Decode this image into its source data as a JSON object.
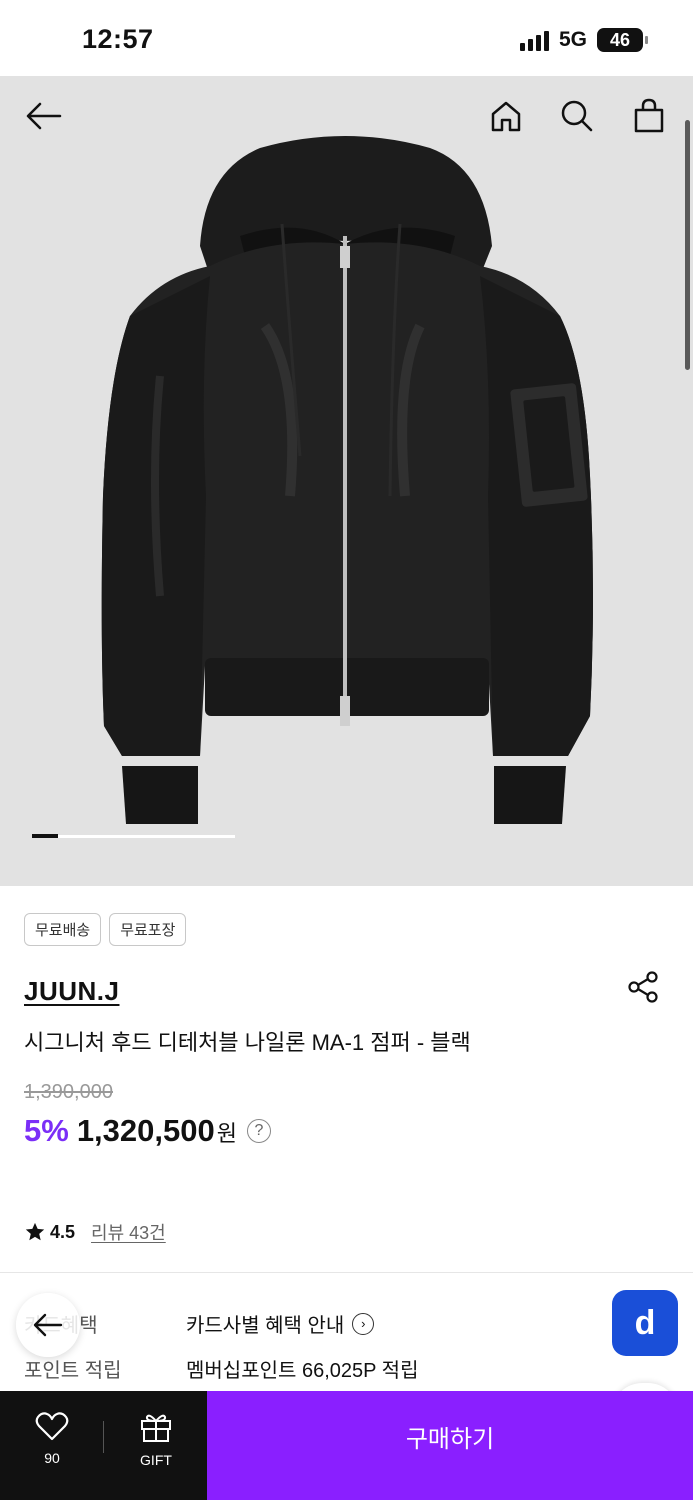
{
  "status": {
    "time": "12:57",
    "network": "5G",
    "battery": "46"
  },
  "header_icons": [
    "back-arrow-icon",
    "home-icon",
    "search-icon",
    "shopping-bag-icon"
  ],
  "gallery": {
    "current_slide": 1,
    "progress": 0.13
  },
  "tags": [
    "무료배송",
    "무료포장"
  ],
  "product": {
    "brand": "JUUN.J",
    "title": "시그니처 후드 디테처블 나일론 MA-1 점퍼 - 블랙",
    "original_price": "1,390,000",
    "discount": "5%",
    "price": "1,320,500",
    "currency": "원",
    "help": "?"
  },
  "rating": {
    "score": "4.5",
    "reviews": "리뷰 43건"
  },
  "benefits": [
    {
      "label": "카드혜택",
      "value": "카드사별 혜택 안내"
    },
    {
      "label": "포인트 적립",
      "value": "멤버십포인트 66,025P 적립"
    }
  ],
  "floating": {
    "d_label": "d"
  },
  "bottom": {
    "like_count": "90",
    "gift_label": "GIFT",
    "buy_label": "구매하기"
  },
  "colors": {
    "accent": "#8a1fff",
    "discount": "#7b2ff7",
    "d_button": "#1a4fd8"
  }
}
